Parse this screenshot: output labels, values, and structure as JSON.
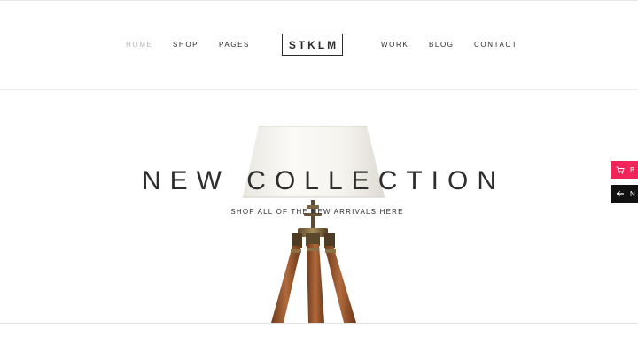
{
  "nav": {
    "left": [
      {
        "label": "HOME",
        "active": true
      },
      {
        "label": "SHOP",
        "active": false
      },
      {
        "label": "PAGES",
        "active": false
      }
    ],
    "right": [
      {
        "label": "WORK",
        "active": false
      },
      {
        "label": "BLOG",
        "active": false
      },
      {
        "label": "CONTACT",
        "active": false
      }
    ]
  },
  "logo": {
    "text": "STKLM"
  },
  "hero": {
    "title": "NEW COLLECTION",
    "subtitle": "SHOP ALL OF THE NEW ARRIVALS HERE"
  },
  "side_buttons": {
    "cart": {
      "icon": "cart-icon",
      "label": "B",
      "color": "#f3245a"
    },
    "back": {
      "icon": "arrow-left-icon",
      "label": "N",
      "color": "#111111"
    }
  },
  "colors": {
    "text": "#2b2b2b",
    "nav_active": "#b4b4b4",
    "accent": "#f3245a"
  }
}
